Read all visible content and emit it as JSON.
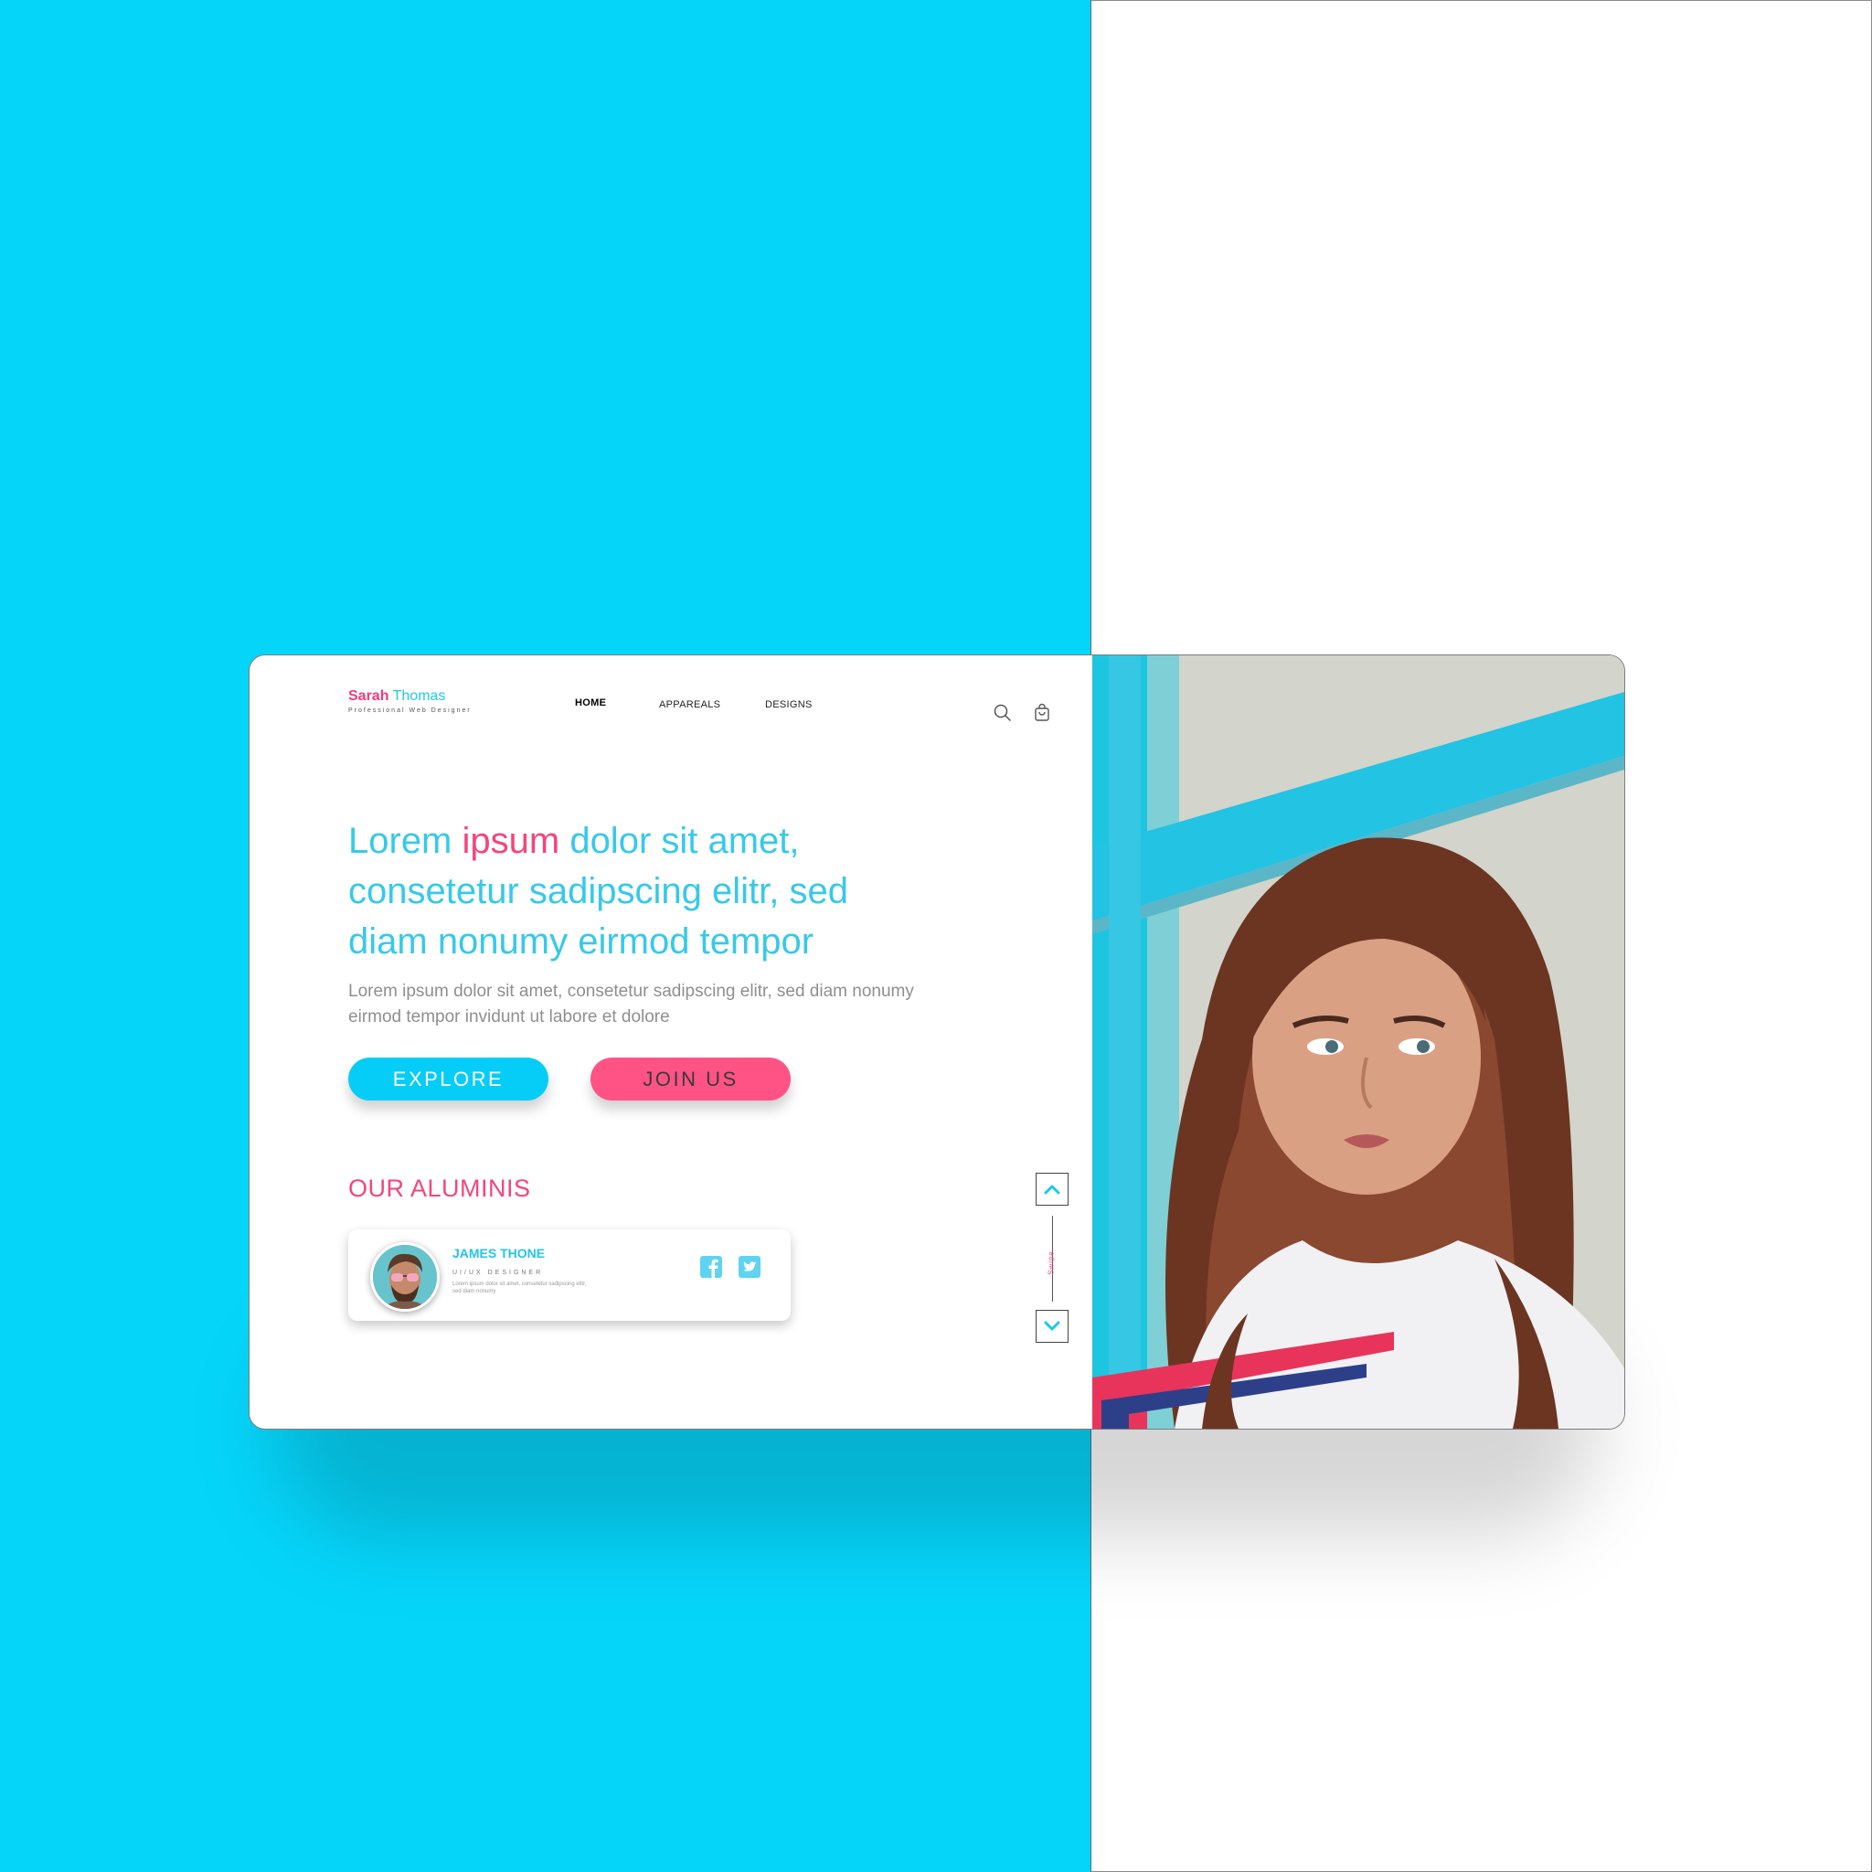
{
  "brand": {
    "first_name": "Sarah",
    "last_name": "Thomas",
    "tagline": "Professional Web Designer"
  },
  "nav": {
    "items": [
      {
        "label": "HOME",
        "active": true
      },
      {
        "label": "APPAREALS",
        "active": false
      },
      {
        "label": "DESIGNS",
        "active": false
      }
    ]
  },
  "header_icons": [
    "search-icon",
    "shopping-bag-icon"
  ],
  "hero": {
    "headline_part1": "Lorem ",
    "headline_highlight": "ipsum",
    "headline_part2": " dolor sit amet, consetetur sadipscing elitr, sed diam nonumy eirmod tempor",
    "subtext": "Lorem ipsum dolor sit amet, consetetur sadipscing elitr, sed diam nonumy eirmod tempor invidunt ut labore et dolore",
    "explore_label": "EXPLORE",
    "join_label": "JOIN US"
  },
  "alumni": {
    "title": "OUR ALUMINIS",
    "card": {
      "name": "JAMES THONE",
      "role": "UI/UX DESIGNER",
      "description": "Lorem ipsum dolor sit amet, consetetur sadipscing elitr, sed diam nonumy",
      "social": [
        "facebook-icon",
        "twitter-icon"
      ]
    }
  },
  "swipe": {
    "label": "Swipe"
  },
  "colors": {
    "background_cyan": "#06d5fa",
    "accent_cyan": "#36c9ea",
    "accent_pink": "#f3467c",
    "explore_button": "#06cdf7",
    "join_button": "#ff5385"
  }
}
